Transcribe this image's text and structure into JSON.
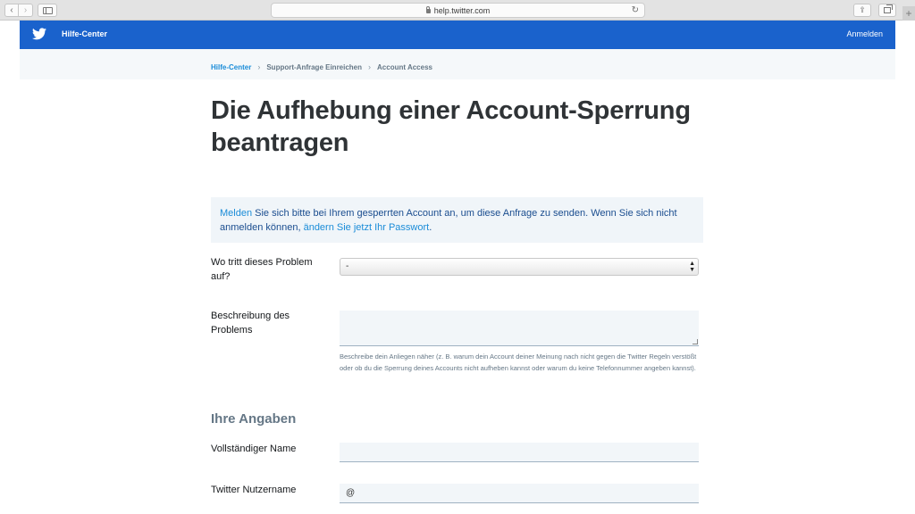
{
  "browser": {
    "url": "help.twitter.com",
    "back_glyph": "‹",
    "forward_glyph": "›",
    "reload_glyph": "↻",
    "share_glyph": "⇪",
    "newtab_glyph": "+"
  },
  "header": {
    "brand": "Hilfe-Center",
    "login": "Anmelden",
    "color": "#1a62cc"
  },
  "breadcrumb": {
    "items": [
      "Hilfe-Center",
      "Support-Anfrage Einreichen",
      "Account Access"
    ],
    "separator": "›"
  },
  "page": {
    "title": "Die Aufhebung einer Account-Sperrung beantragen"
  },
  "notice": {
    "link1": "Melden",
    "text1": " Sie sich bitte bei Ihrem gesperrten Account an, um diese Anfrage zu senden. Wenn Sie sich nicht anmelden können, ",
    "link2": "ändern Sie jetzt Ihr Passwort",
    "text2": "."
  },
  "form": {
    "problem_location": {
      "label": "Wo tritt dieses Problem auf?",
      "selected": "-"
    },
    "description": {
      "label": "Beschreibung des Problems",
      "help": "Beschreibe dein Anliegen näher (z. B. warum dein Account deiner Meinung nach nicht gegen die Twitter Regeln verstößt oder ob du die Sperrung deines Accounts nicht aufheben kannst oder warum du keine Telefonnummer angeben kannst)."
    },
    "section_heading": "Ihre Angaben",
    "full_name": {
      "label": "Vollständiger Name",
      "value": ""
    },
    "username": {
      "label": "Twitter Nutzername",
      "value": "@"
    }
  }
}
